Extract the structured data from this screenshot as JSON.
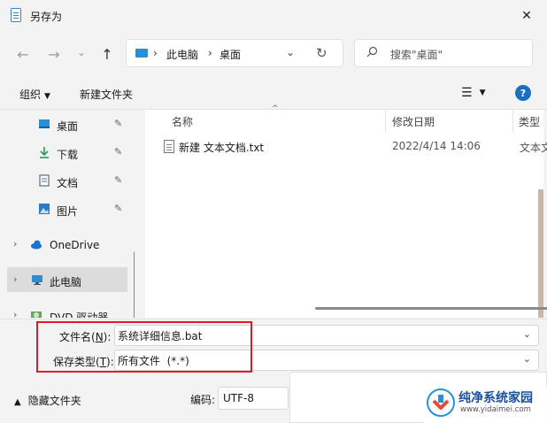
{
  "window": {
    "title": "另存为",
    "close_glyph": "✕"
  },
  "nav": {
    "back_glyph": "←",
    "forward_glyph": "→",
    "recent_glyph": "⌄",
    "up_glyph": "↑",
    "address": {
      "segments": [
        "此电脑",
        "桌面"
      ],
      "separator": "›",
      "dropdown_glyph": "⌄",
      "refresh_glyph": "↻"
    },
    "search": {
      "placeholder": "搜索\"桌面\""
    }
  },
  "toolbar": {
    "organize": "组织",
    "new_folder": "新建文件夹",
    "view_glyph": "☰",
    "help": "?"
  },
  "sidebar": {
    "items": [
      {
        "label": "桌面",
        "icon": "desktop-icon",
        "pinned": true
      },
      {
        "label": "下载",
        "icon": "download-icon",
        "pinned": true
      },
      {
        "label": "文档",
        "icon": "document-icon",
        "pinned": true
      },
      {
        "label": "图片",
        "icon": "picture-icon",
        "pinned": true
      },
      {
        "label": "OneDrive",
        "icon": "cloud-icon",
        "expandable": true
      },
      {
        "label": "此电脑",
        "icon": "computer-icon",
        "expandable": true,
        "selected": true
      },
      {
        "label": "DVD 驱动器 (D:)",
        "icon": "dvd-icon",
        "expandable": true
      }
    ],
    "pin_glyph": "📌",
    "chevron_glyph": "›"
  },
  "columns": {
    "name": "名称",
    "date": "修改日期",
    "type": "类型",
    "sort_glyph": "^"
  },
  "files": [
    {
      "name": "新建 文本文档.txt",
      "date": "2022/4/14 14:06",
      "type": "文本文"
    }
  ],
  "form": {
    "filename_label": "文件名(",
    "filename_key": "N",
    "filename_value": "系统详细信息.bat",
    "filetype_label": "保存类型(",
    "filetype_key": "T",
    "filetype_value": "所有文件  (*.*)",
    "close_paren": "):"
  },
  "footer": {
    "hide_folders": "隐藏文件夹",
    "encoding_label": "编码:",
    "encoding_value": "UTF-8"
  },
  "watermark": {
    "title": "纯净系统家园",
    "url": "www.yidaimei.com"
  },
  "colors": {
    "accent": "#1b6ec2",
    "highlight_box": "#e01b24"
  }
}
